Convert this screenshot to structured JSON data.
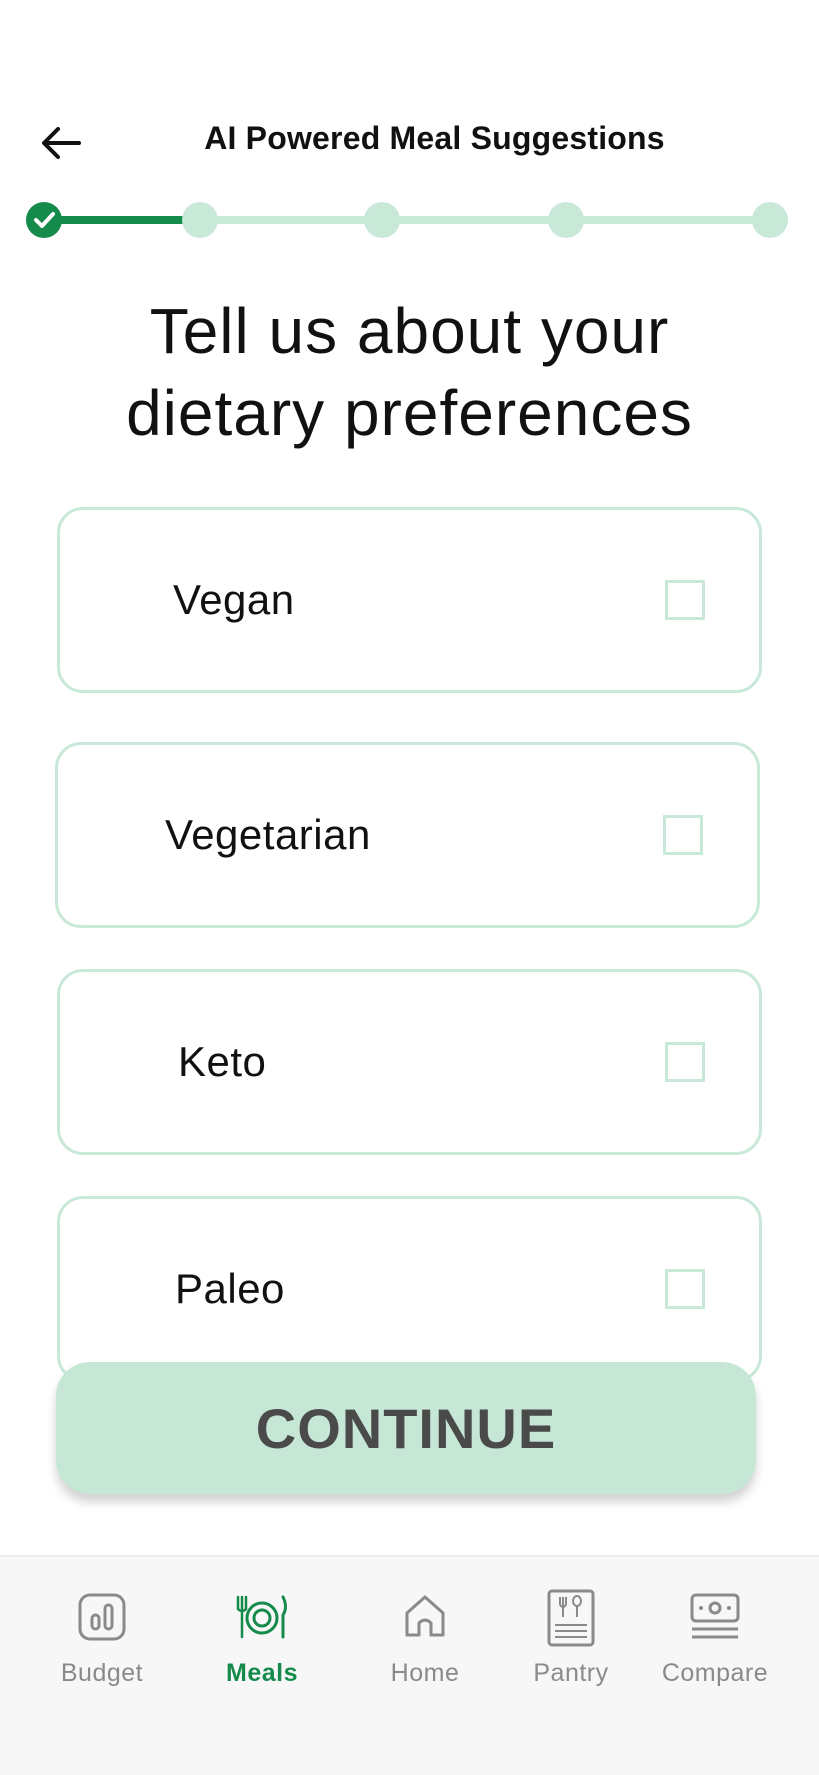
{
  "header": {
    "title": "AI Powered Meal Suggestions",
    "back_icon": "arrow-left-icon"
  },
  "stepper": {
    "total_steps": 5,
    "current_step": 1,
    "completed_color": "#148a4b",
    "pending_color": "#c8e8d8"
  },
  "question": {
    "line1": "Tell us about your",
    "line2": "dietary preferences"
  },
  "options": [
    {
      "label": "Vegan",
      "checked": false
    },
    {
      "label": "Vegetarian",
      "checked": false
    },
    {
      "label": "Keto",
      "checked": false
    },
    {
      "label": "Paleo",
      "checked": false
    }
  ],
  "continue_button": {
    "label": "CONTINUE"
  },
  "bottom_nav": {
    "items": [
      {
        "label": "Budget",
        "icon": "budget-chart-icon",
        "active": false
      },
      {
        "label": "Meals",
        "icon": "meals-plate-icon",
        "active": true
      },
      {
        "label": "Home",
        "icon": "home-icon",
        "active": false
      },
      {
        "label": "Pantry",
        "icon": "pantry-menu-icon",
        "active": false
      },
      {
        "label": "Compare",
        "icon": "compare-money-icon",
        "active": false
      }
    ]
  },
  "colors": {
    "accent": "#148a4b",
    "accent_light": "#c6e6d6",
    "border": "#c8e8d8",
    "inactive_nav": "#8a8a8a"
  }
}
